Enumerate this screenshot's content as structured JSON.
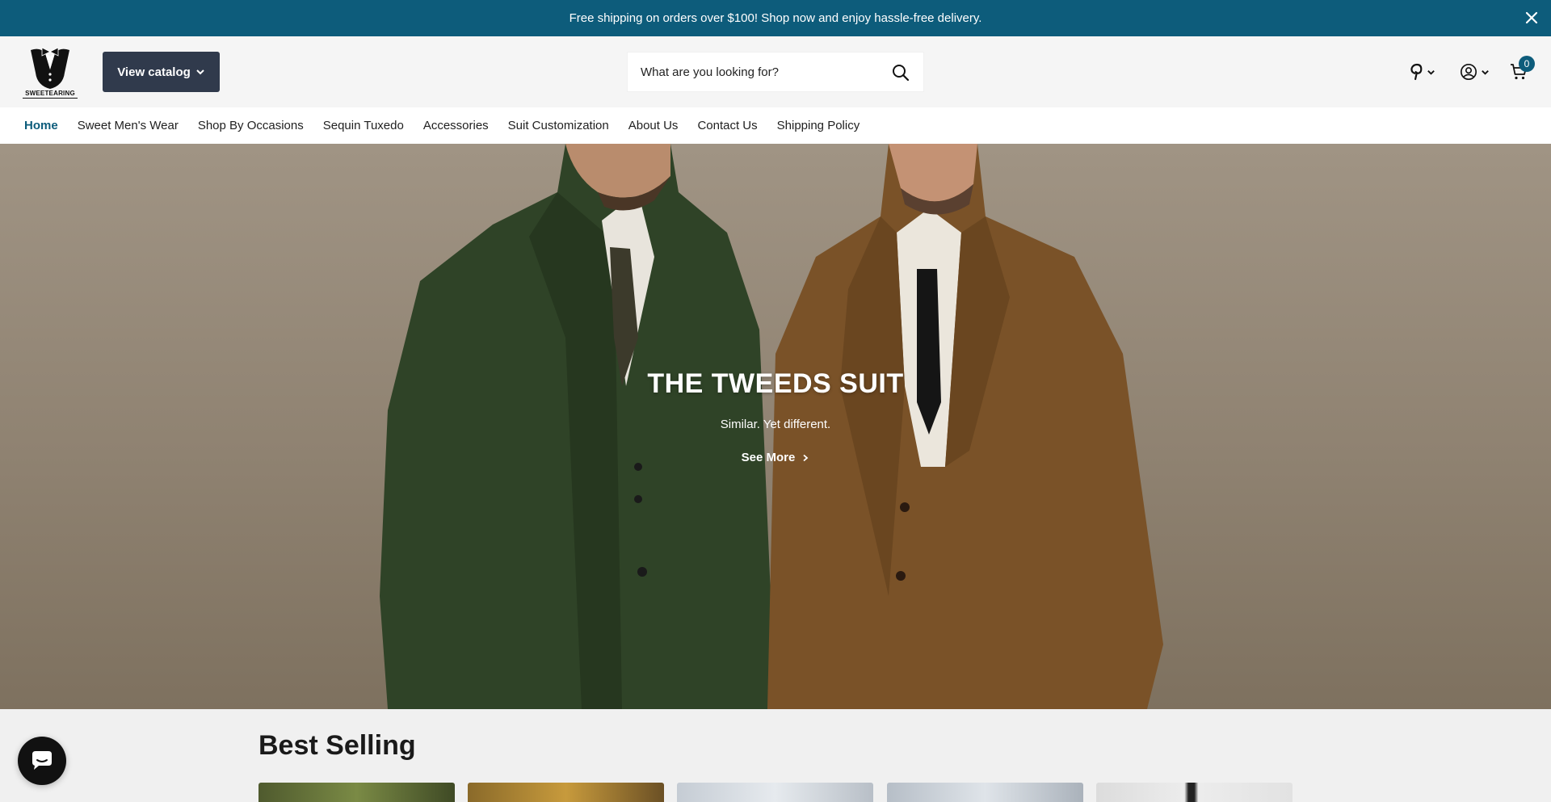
{
  "announcement": {
    "text": "Free shipping on orders over $100! Shop now and enjoy hassle-free delivery."
  },
  "header": {
    "logo_text": "SWEETEARING",
    "catalog_label": "View catalog",
    "search_placeholder": "What are you looking for?",
    "cart_count": "0"
  },
  "nav": {
    "items": [
      {
        "label": "Home"
      },
      {
        "label": "Sweet Men's Wear"
      },
      {
        "label": "Shop By Occasions"
      },
      {
        "label": "Sequin Tuxedo"
      },
      {
        "label": "Accessories"
      },
      {
        "label": "Suit Customization"
      },
      {
        "label": "About Us"
      },
      {
        "label": "Contact Us"
      },
      {
        "label": "Shipping Policy"
      }
    ]
  },
  "hero": {
    "title": "THE TWEEDS SUIT",
    "subtitle": "Similar. Yet different.",
    "cta": "See More"
  },
  "best_selling": {
    "title": "Best Selling"
  },
  "colors": {
    "brand": "#0d5c7b",
    "catalog_button": "#303a4c"
  },
  "icons": [
    "close-icon",
    "tuxedo-logo-icon",
    "chevron-down-icon",
    "search-icon",
    "pinterest-icon",
    "account-icon",
    "cart-icon",
    "chevron-right-icon",
    "chat-icon"
  ]
}
